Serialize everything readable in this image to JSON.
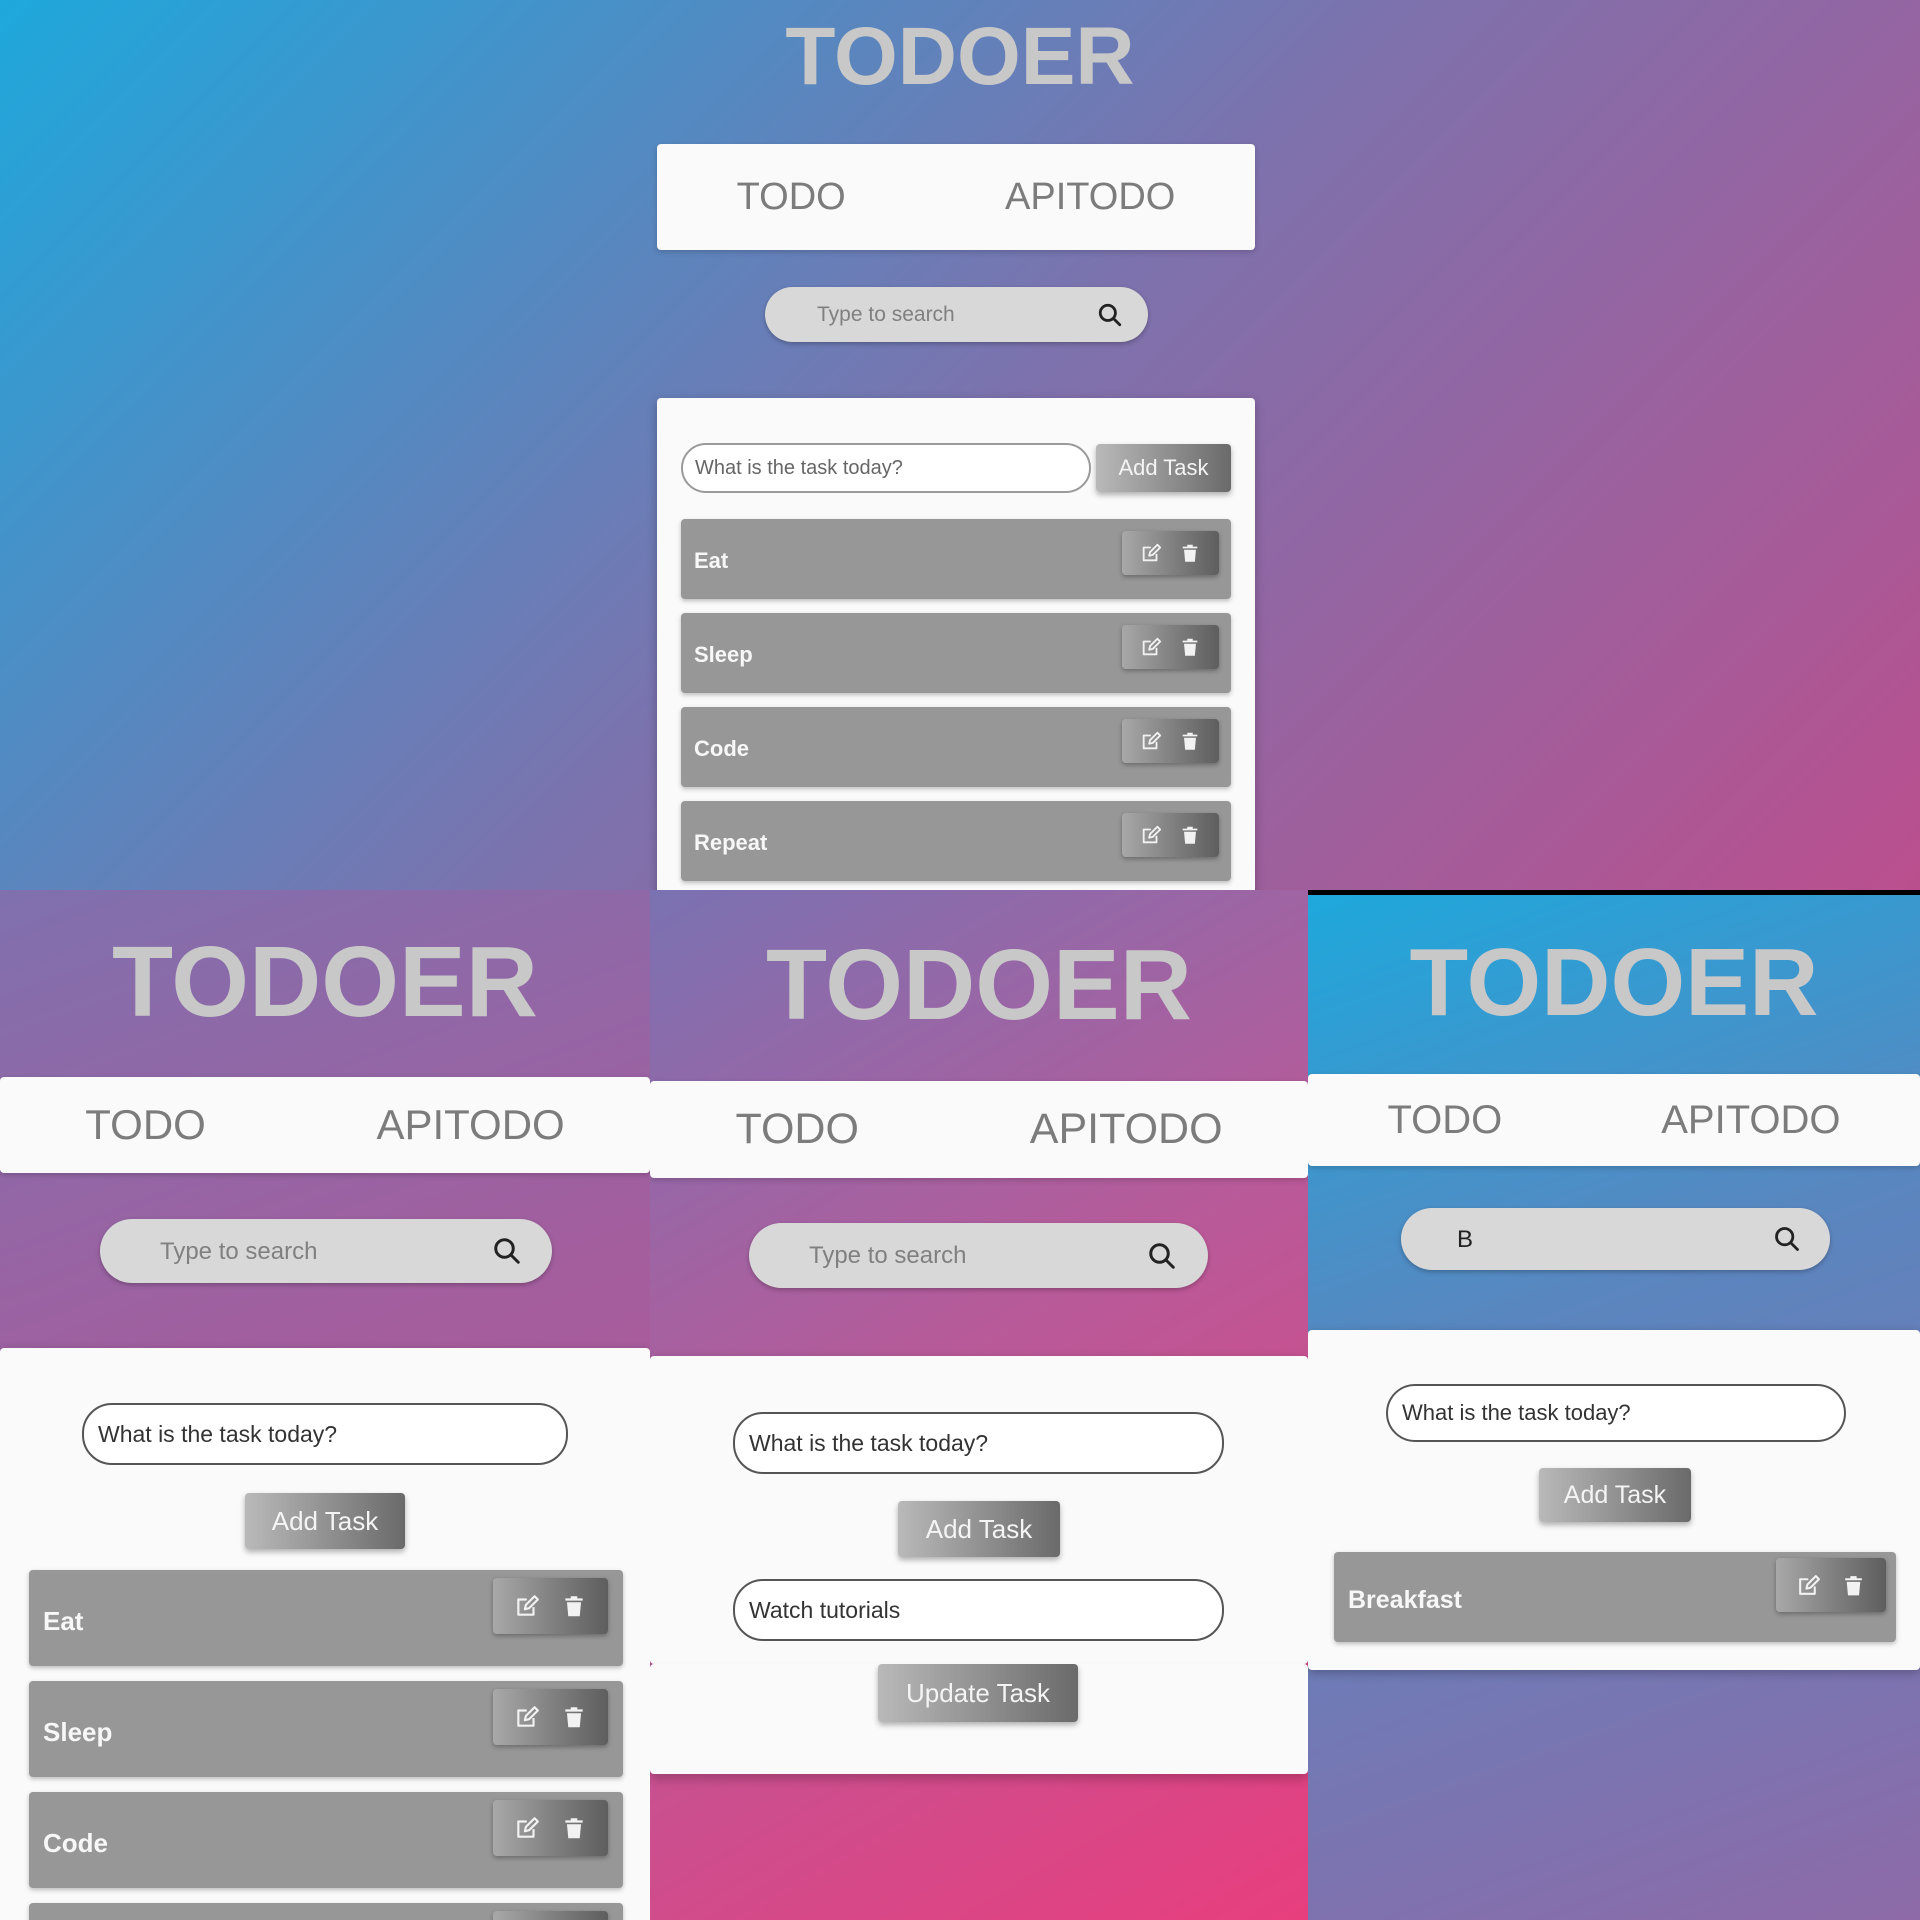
{
  "app_title": "TODOER",
  "tabs": {
    "todo": "TODO",
    "apitodo": "APITODO"
  },
  "search": {
    "placeholder": "Type to search",
    "query_filtered": "B"
  },
  "task_input": {
    "placeholder": "What is the task today?",
    "value_filled": "What is the task today?",
    "edit_value": "Watch tutorials"
  },
  "buttons": {
    "add_task": "Add Task",
    "update_task": "Update Task"
  },
  "tasks": [
    "Eat",
    "Sleep",
    "Code",
    "Repeat"
  ],
  "filtered_tasks": [
    "Breakfast"
  ],
  "icons": {
    "search": "search-icon",
    "edit": "edit-icon",
    "delete": "trash-icon"
  },
  "colors": {
    "gradient_blue": "#1ea8dc",
    "gradient_purple": "#7d72ad",
    "gradient_pink": "#e83e7e",
    "task_item": "#979797",
    "title": "#c8c8c8"
  }
}
